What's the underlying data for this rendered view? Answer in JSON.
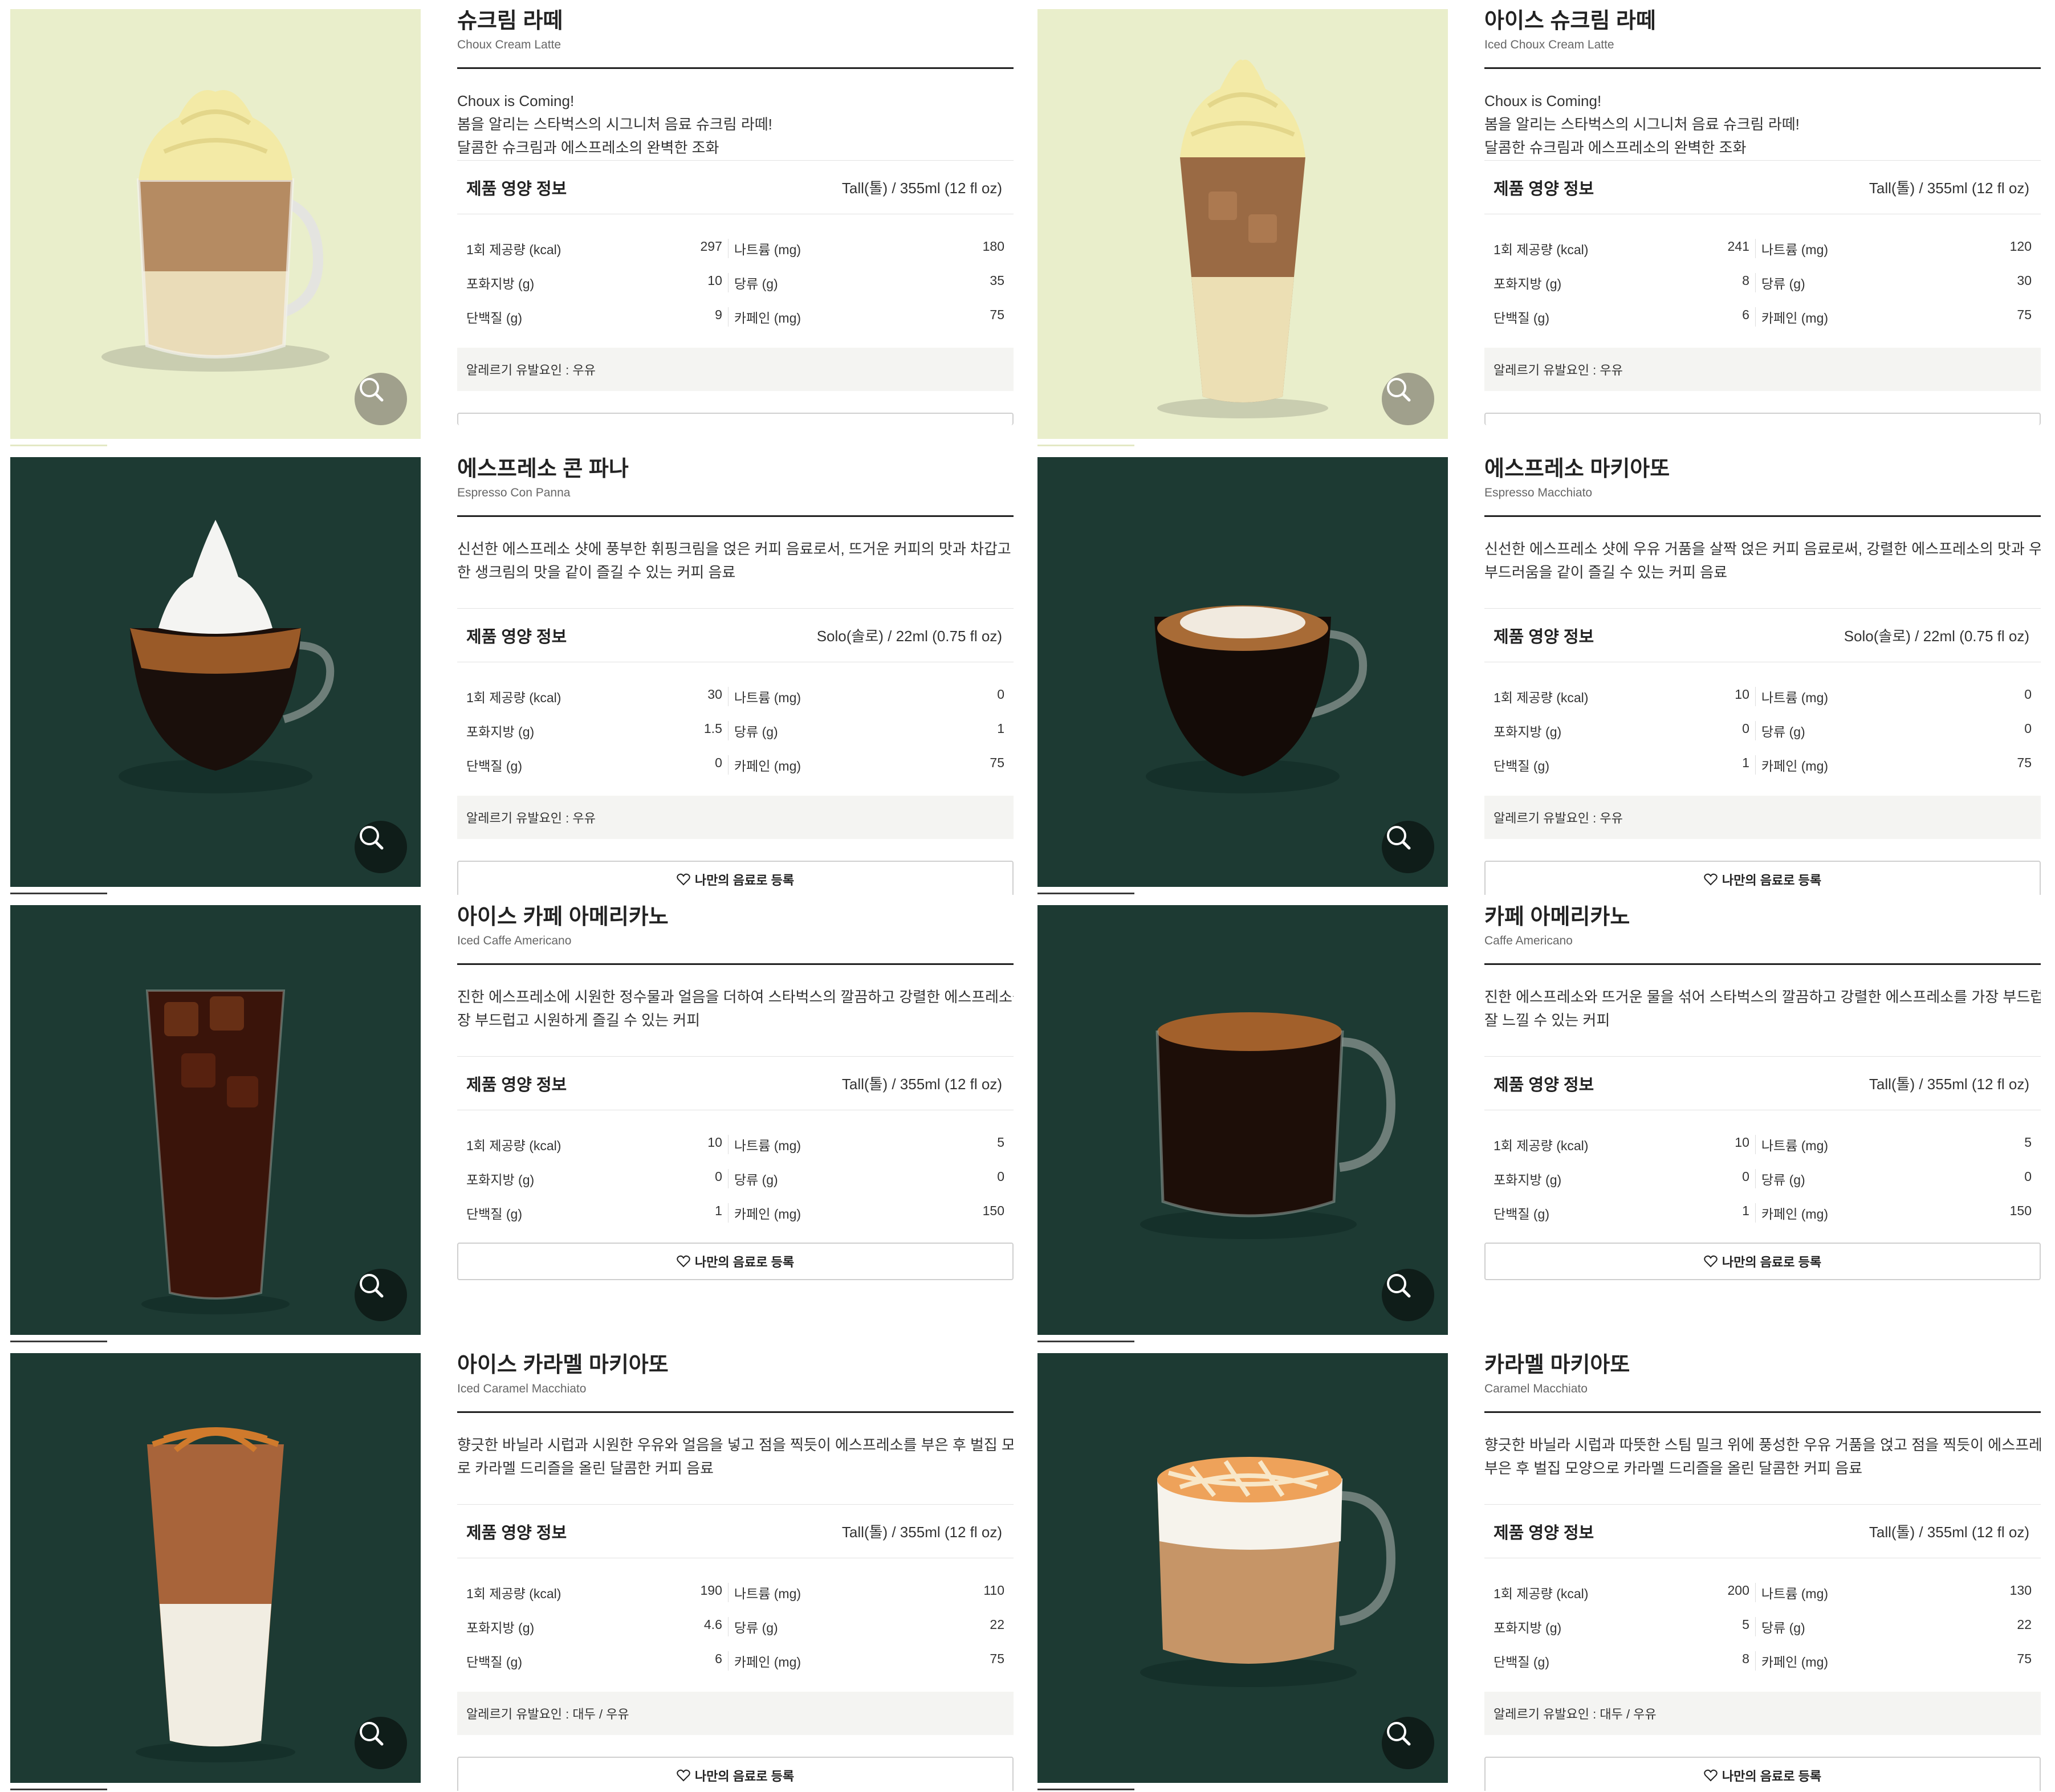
{
  "colors": {
    "light_bg": "#e9eecb",
    "dark_bg": "#1d3a33",
    "zoom_light": "#a0a08c",
    "zoom_dark": "#0f1d19"
  },
  "common": {
    "nutrition_title": "제품 영양 정보",
    "fav_label": "나만의 음료로 등록",
    "zoom_icon": "magnifier-icon",
    "heart_icon": "heart-icon",
    "nutrition_labels": {
      "kcal": "1회 제공량 (kcal)",
      "sodium": "나트륨 (mg)",
      "satfat": "포화지방 (g)",
      "sugar": "당류 (g)",
      "protein": "단백질 (g)",
      "caffeine": "카페인 (mg)"
    }
  },
  "products": [
    {
      "name_ko": "슈크림 라떼",
      "name_en": "Choux Cream Latte",
      "bg": "light",
      "desc": [
        "Choux is Coming!",
        "봄을 알리는 스타벅스의 시그니처 음료 슈크림 라떼!",
        "달콤한 슈크림과 에스프레소의 완벽한 조화"
      ],
      "size": "Tall(톨) / 355ml (12 fl oz)",
      "kcal": "297",
      "sodium": "180",
      "satfat": "10",
      "sugar": "35",
      "protein": "9",
      "caffeine": "75",
      "allergy": "알레르기 유발요인 : 우유",
      "show_fav": false
    },
    {
      "name_ko": "아이스 슈크림 라떼",
      "name_en": "Iced Choux Cream Latte",
      "bg": "light",
      "desc": [
        "Choux is Coming!",
        "봄을 알리는 스타벅스의 시그니처 음료 슈크림 라떼!",
        "달콤한 슈크림과 에스프레소의 완벽한 조화"
      ],
      "size": "Tall(톨) / 355ml (12 fl oz)",
      "kcal": "241",
      "sodium": "120",
      "satfat": "8",
      "sugar": "30",
      "protein": "6",
      "caffeine": "75",
      "allergy": "알레르기 유발요인 : 우유",
      "show_fav": false
    },
    {
      "name_ko": "에스프레소 콘 파나",
      "name_en": "Espresso Con Panna",
      "bg": "dark",
      "desc": [
        "신선한 에스프레소 샷에 풍부한 휘핑크림을 얹은 커피 음료로서, 뜨거운 커피의 맛과 차갑고 달콤",
        "한 생크림의 맛을 같이 즐길 수 있는 커피 음료"
      ],
      "size": "Solo(솔로) / 22ml (0.75 fl oz)",
      "kcal": "30",
      "sodium": "0",
      "satfat": "1.5",
      "sugar": "1",
      "protein": "0",
      "caffeine": "75",
      "allergy": "알레르기 유발요인 : 우유",
      "show_fav": true
    },
    {
      "name_ko": "에스프레소 마키아또",
      "name_en": "Espresso Macchiato",
      "bg": "dark",
      "desc": [
        "신선한 에스프레소 샷에 우유 거품을 살짝 얹은 커피 음료로써, 강렬한 에스프레소의 맛과 우유의",
        "부드러움을 같이 즐길 수 있는 커피 음료"
      ],
      "size": "Solo(솔로) / 22ml (0.75 fl oz)",
      "kcal": "10",
      "sodium": "0",
      "satfat": "0",
      "sugar": "0",
      "protein": "1",
      "caffeine": "75",
      "allergy": "알레르기 유발요인 : 우유",
      "show_fav": true
    },
    {
      "name_ko": "아이스 카페 아메리카노",
      "name_en": "Iced Caffe Americano",
      "bg": "dark",
      "desc": [
        "진한 에스프레소에 시원한 정수물과 얼음을 더하여 스타벅스의 깔끔하고 강렬한 에스프레소를 가",
        "장 부드럽고 시원하게 즐길 수 있는 커피"
      ],
      "size": "Tall(톨) / 355ml (12 fl oz)",
      "kcal": "10",
      "sodium": "5",
      "satfat": "0",
      "sugar": "0",
      "protein": "1",
      "caffeine": "150",
      "allergy": "",
      "show_fav": true
    },
    {
      "name_ko": "카페 아메리카노",
      "name_en": "Caffe Americano",
      "bg": "dark",
      "desc": [
        "진한 에스프레소와 뜨거운 물을 섞어 스타벅스의 깔끔하고 강렬한 에스프레소를 가장 부드럽게",
        "잘 느낄 수 있는 커피"
      ],
      "size": "Tall(톨) / 355ml (12 fl oz)",
      "kcal": "10",
      "sodium": "5",
      "satfat": "0",
      "sugar": "0",
      "protein": "1",
      "caffeine": "150",
      "allergy": "",
      "show_fav": true
    },
    {
      "name_ko": "아이스 카라멜 마키아또",
      "name_en": "Iced Caramel Macchiato",
      "bg": "dark",
      "desc": [
        "향긋한 바닐라 시럽과 시원한 우유와 얼음을 넣고 점을 찍듯이 에스프레소를 부은 후 벌집 모양으",
        "로 카라멜 드리즐을 올린 달콤한 커피 음료"
      ],
      "size": "Tall(톨) / 355ml (12 fl oz)",
      "kcal": "190",
      "sodium": "110",
      "satfat": "4.6",
      "sugar": "22",
      "protein": "6",
      "caffeine": "75",
      "allergy": "알레르기 유발요인 : 대두 / 우유",
      "show_fav": true
    },
    {
      "name_ko": "카라멜 마키아또",
      "name_en": "Caramel Macchiato",
      "bg": "dark",
      "desc": [
        "향긋한 바닐라 시럽과 따뜻한 스팀 밀크 위에 풍성한 우유 거품을 얹고 점을 찍듯이 에스프레소를",
        "부은 후 벌집 모양으로 카라멜 드리즐을 올린 달콤한 커피 음료"
      ],
      "size": "Tall(톨) / 355ml (12 fl oz)",
      "kcal": "200",
      "sodium": "130",
      "satfat": "5",
      "sugar": "22",
      "protein": "8",
      "caffeine": "75",
      "allergy": "알레르기 유발요인 : 대두 / 우유",
      "show_fav": true
    }
  ]
}
